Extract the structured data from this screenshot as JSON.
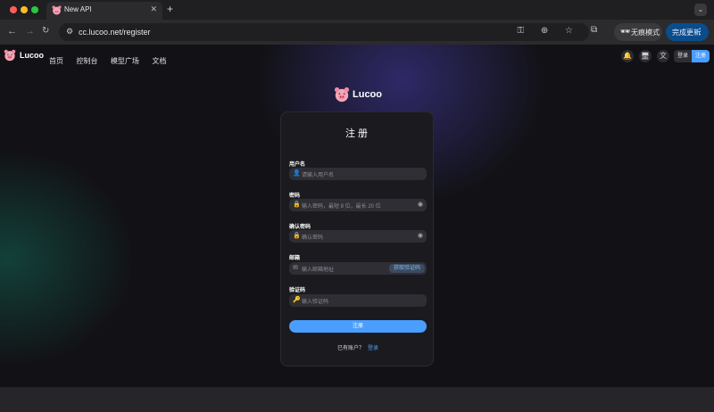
{
  "browser": {
    "tab_title": "New API",
    "tab_close": "✕",
    "new_tab": "+",
    "tab_menu": "⌄",
    "url": "cc.lucoo.net/register",
    "incognito_label": "无痕模式",
    "update_label": "完成更新",
    "update_more": "⋮",
    "back": "←",
    "forward": "→",
    "reload": "↻",
    "site_info_icon": "⚙",
    "omni_icons": "⚿ ⊕ ☆",
    "extensions_icon": "⧉",
    "incognito_icon": "🕶"
  },
  "app": {
    "brand": "Lucoo",
    "nav": [
      "首页",
      "控制台",
      "模型广场",
      "文档"
    ],
    "header_icons": {
      "bell": "🔔",
      "monitor": "🖥",
      "language": "文"
    },
    "login_label": "登录",
    "register_label": "注册"
  },
  "form": {
    "title": "注册",
    "fields": [
      {
        "label": "用户名",
        "placeholder": "请输入用户名",
        "icon": "user-icon",
        "glyph": "👤"
      },
      {
        "label": "密码",
        "placeholder": "输入密码，最短 8 位，最长 20 位",
        "icon": "lock-icon",
        "glyph": "🔒",
        "eye": "◉"
      },
      {
        "label": "确认密码",
        "placeholder": "确认密码",
        "icon": "lock-icon",
        "glyph": "🔒",
        "eye": "◉"
      },
      {
        "label": "邮箱",
        "placeholder": "输入邮箱地址",
        "icon": "mail-icon",
        "glyph": "✉",
        "button": "获取验证码"
      },
      {
        "label": "验证码",
        "placeholder": "输入验证码",
        "icon": "key-icon",
        "glyph": "🔑"
      }
    ],
    "submit": "注册",
    "footer_text": "已有账户？",
    "footer_link": "登录"
  },
  "colors": {
    "accent": "#4a9eff",
    "background": "#121216",
    "card": "#1b1b1f"
  }
}
